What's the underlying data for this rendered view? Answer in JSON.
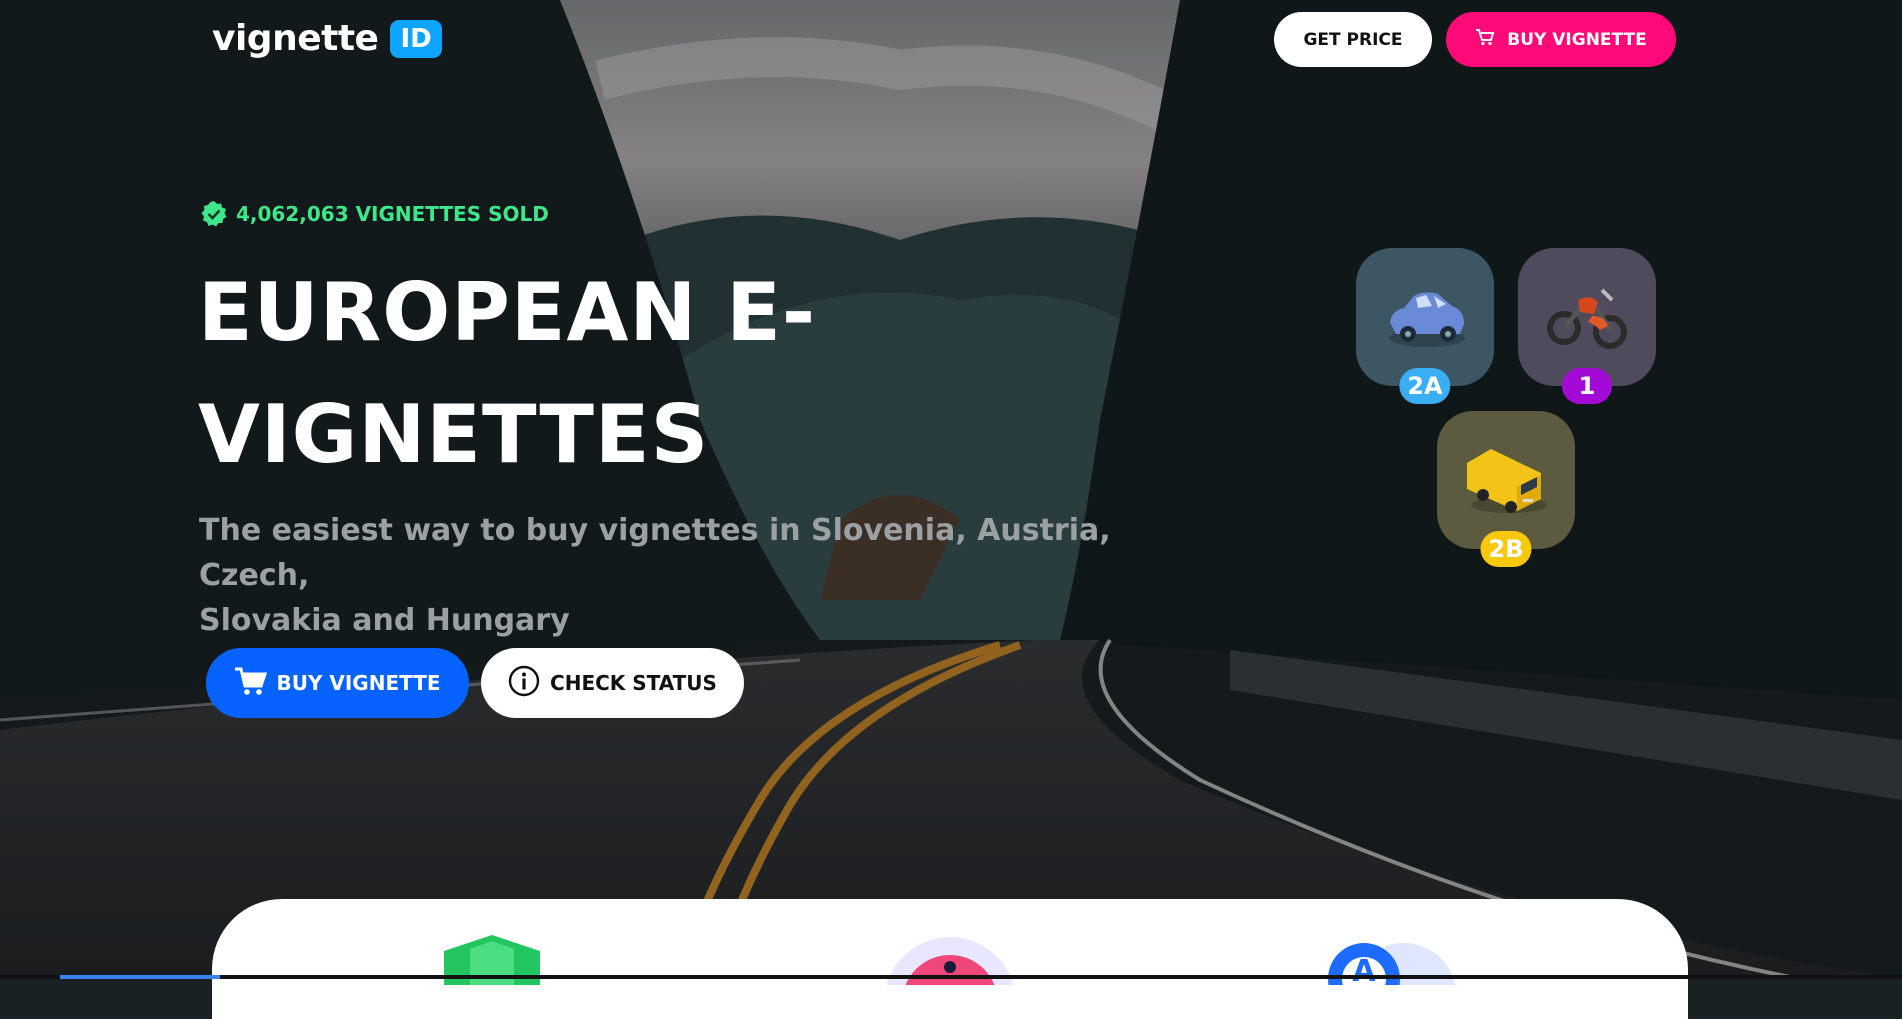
{
  "brand": {
    "name": "vignette",
    "badge": "ID"
  },
  "nav": {
    "get_price": "GET PRICE",
    "buy_vignette": "BUY VIGNETTE"
  },
  "hero": {
    "sold_text": "4,062,063 VIGNETTES SOLD",
    "headline_line1": "EUROPEAN E-",
    "headline_line2": "VIGNETTES",
    "subtitle_line1": "The easiest way to buy vignettes in Slovenia, Austria, Czech,",
    "subtitle_line2": "Slovakia and Hungary",
    "buy_button": "BUY VIGNETTE",
    "check_button": "CHECK STATUS"
  },
  "vehicle_classes": [
    {
      "label": "2A",
      "icon": "car-icon",
      "badge_color": "#3aaef5"
    },
    {
      "label": "1",
      "icon": "motorcycle-icon",
      "badge_color": "#a40ad6"
    },
    {
      "label": "2B",
      "icon": "van-icon",
      "badge_color": "#f7c80b"
    }
  ],
  "colors": {
    "accent_blue": "#0663ff",
    "accent_pink": "#ff0a78",
    "sold_green": "#3ee88a",
    "logo_blue": "#0ea5ff"
  }
}
